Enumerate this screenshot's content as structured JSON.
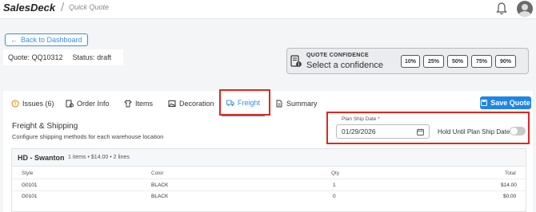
{
  "header": {
    "brand": "SalesDeck",
    "separator": "/",
    "page_name": "Quick Quote"
  },
  "back_button": {
    "label": "Back to Dashboard"
  },
  "quote": {
    "id_label": "Quote: QQ10312",
    "status_label": "Status: draft"
  },
  "confidence": {
    "label": "QUOTE CONFIDENCE",
    "prompt": "Select a confidence",
    "options": [
      "10%",
      "25%",
      "50%",
      "75%",
      "90%"
    ]
  },
  "tabs": [
    {
      "label": "Issues (6)",
      "icon": "alert-circle-icon"
    },
    {
      "label": "Order Info",
      "icon": "order-info-icon"
    },
    {
      "label": "Items",
      "icon": "shirt-icon"
    },
    {
      "label": "Decoration",
      "icon": "image-icon"
    },
    {
      "label": "Freight",
      "icon": "truck-icon"
    },
    {
      "label": "Summary",
      "icon": "document-icon"
    }
  ],
  "active_tab": "Freight",
  "save_button": {
    "label": "Save Quote"
  },
  "freight": {
    "title": "Freight & Shipping",
    "subtitle": "Configure shipping methods for each warehouse location",
    "ship_date_label": "Plan Ship Date *",
    "ship_date_value": "01/29/2026",
    "hold_label": "Hold Until Plan Ship Date",
    "hold_enabled": false
  },
  "warehouse": {
    "name": "HD - Swanton",
    "meta": "1 items • $14.00 • 2 lines",
    "columns": [
      "Style",
      "Color",
      "Qty",
      "Total"
    ],
    "rows": [
      {
        "style": "G0101",
        "color": "BLACK",
        "qty": "1",
        "total": "$14.00"
      },
      {
        "style": "G0101",
        "color": "BLACK",
        "qty": "0",
        "total": "$0.00"
      }
    ]
  },
  "colors": {
    "accent": "#1d87e6",
    "highlight": "#e0261f"
  }
}
